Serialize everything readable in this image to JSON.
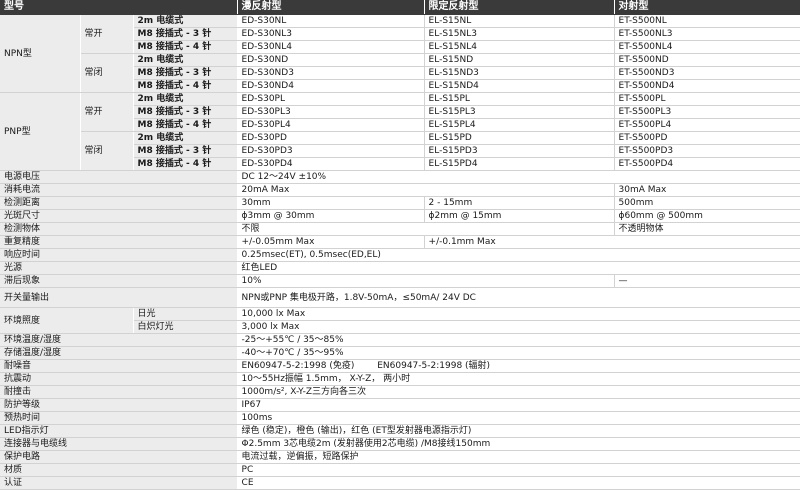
{
  "header": {
    "model": "型号",
    "diffuse": "漫反射型",
    "limited": "限定反射型",
    "through": "对射型"
  },
  "models": {
    "npn": "NPN型",
    "pnp": "PNP型",
    "no": "常开",
    "nc": "常闭",
    "types": [
      "2m 电缆式",
      "M8 接插式 - 3 针",
      "M8 接插式 - 4 针"
    ],
    "npn_no": [
      [
        "ED-S30NL",
        "EL-S15NL",
        "ET-S500NL"
      ],
      [
        "ED-S30NL3",
        "EL-S15NL3",
        "ET-S500NL3"
      ],
      [
        "ED-S30NL4",
        "EL-S15NL4",
        "ET-S500NL4"
      ]
    ],
    "npn_nc": [
      [
        "ED-S30ND",
        "EL-S15ND",
        "ET-S500ND"
      ],
      [
        "ED-S30ND3",
        "EL-S15ND3",
        "ET-S500ND3"
      ],
      [
        "ED-S30ND4",
        "EL-S15ND4",
        "ET-S500ND4"
      ]
    ],
    "pnp_no": [
      [
        "ED-S30PL",
        "EL-S15PL",
        "ET-S500PL"
      ],
      [
        "ED-S30PL3",
        "EL-S15PL3",
        "ET-S500PL3"
      ],
      [
        "ED-S30PL4",
        "EL-S15PL4",
        "ET-S500PL4"
      ]
    ],
    "pnp_nc": [
      [
        "ED-S30PD",
        "EL-S15PD",
        "ET-S500PD"
      ],
      [
        "ED-S30PD3",
        "EL-S15PD3",
        "ET-S500PD3"
      ],
      [
        "ED-S30PD4",
        "EL-S15PD4",
        "ET-S500PD4"
      ]
    ]
  },
  "specs": {
    "supply_voltage": {
      "label": "电源电压",
      "value": "DC 12～24V ±10%"
    },
    "current": {
      "label": "消耗电流",
      "diffuse_limited": "20mA Max",
      "through": "30mA Max"
    },
    "distance": {
      "label": "检测距离",
      "diffuse": "30mm",
      "limited": "2 - 15mm",
      "through": "500mm"
    },
    "spot": {
      "label": "光斑尺寸",
      "diffuse": "ϕ3mm @ 30mm",
      "limited": "ϕ2mm @ 15mm",
      "through": "ϕ60mm @ 500mm"
    },
    "object": {
      "label": "检测物体",
      "diffuse_limited": "不限",
      "through": "不透明物体"
    },
    "repeat": {
      "label": "重复精度",
      "diffuse": "+/-0.05mm Max",
      "limited_through": "+/-0.1mm Max"
    },
    "response": {
      "label": "响应时间",
      "value": "0.25msec(ET), 0.5msec(ED,EL)"
    },
    "light": {
      "label": "光源",
      "value": "红色LED"
    },
    "hysteresis": {
      "label": "滞后现象",
      "diffuse_limited": "10%",
      "through": "—"
    },
    "output": {
      "label": "开关量输出",
      "value": "NPN或PNP 集电极开路，1.8V-50mA，≤50mA/ 24V DC"
    },
    "illum": {
      "label": "环境照度",
      "sun": "日光",
      "sun_value": "10,000 lx Max",
      "lamp": "白炽灯光",
      "lamp_value": "3,000 lx Max"
    },
    "ambient": {
      "label": "环境温度/湿度",
      "value": "-25～+55℃ / 35～85%"
    },
    "storage": {
      "label": "存储温度/湿度",
      "value": "-40～+70℃ / 35～95%"
    },
    "noise": {
      "label": "耐噪音",
      "value": "EN60947-5-2:1998 (免疫)        EN60947-5-2:1998 (辐射)"
    },
    "vibration": {
      "label": "抗震动",
      "value": "10～55Hz振幅 1.5mm， X-Y-Z， 两小时"
    },
    "shock": {
      "label": "耐撞击",
      "value": "1000m/s², X-Y-Z三方向各三次"
    },
    "protection": {
      "label": "防护等级",
      "value": "IP67"
    },
    "warmup": {
      "label": "预热时间",
      "value": "100ms"
    },
    "led": {
      "label": "LED指示灯",
      "value": "绿色 (稳定)，橙色 (输出)，红色 (ET型发射器电源指示灯)"
    },
    "connector": {
      "label": "连接器与电缆线",
      "value": "Φ2.5mm 3芯电缆2m (发射器使用2芯电缆) /M8接线150mm"
    },
    "circuit": {
      "label": "保护电路",
      "value": "电流过载，逆偏振，短路保护"
    },
    "material": {
      "label": "材质",
      "value": "PC"
    },
    "cert": {
      "label": "认证",
      "value": "CE"
    }
  }
}
